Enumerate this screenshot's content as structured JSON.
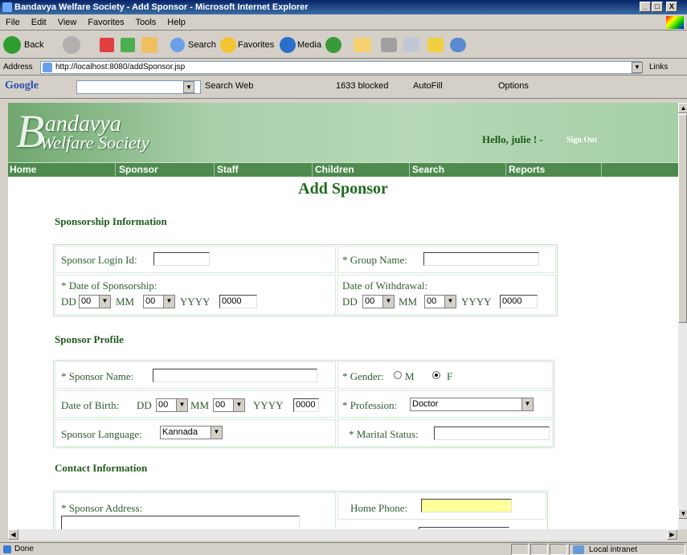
{
  "window": {
    "title": "Bandavya Welfare Society - Add Sponsor - Microsoft Internet Explorer",
    "controls": [
      "_",
      "□",
      "X"
    ]
  },
  "menu": [
    "File",
    "Edit",
    "View",
    "Favorites",
    "Tools",
    "Help"
  ],
  "toolbar": {
    "back": "Back",
    "search": "Search",
    "favorites": "Favorites",
    "media": "Media"
  },
  "address": {
    "label": "Address",
    "url": "http://localhost:8080/addSponsor.jsp",
    "links": "Links"
  },
  "googlebar": {
    "brand": "Google",
    "search_web": "Search Web",
    "blocked": "1633 blocked",
    "autofill": "AutoFill",
    "options": "Options"
  },
  "site": {
    "logo_big": "B",
    "logo_line1": "andavya",
    "logo_line2": "Welfare Society",
    "hello": "Hello,  julie ! -",
    "signout": "Sign Out"
  },
  "nav": [
    "Home",
    "Sponsor",
    "Staff",
    "Children",
    "Search",
    "Reports"
  ],
  "form": {
    "heading": "Add Sponsor",
    "sections": {
      "sponsorship": "Sponsorship Information",
      "profile": "Sponsor Profile",
      "contact": "Contact Information"
    },
    "login_id_label": "Sponsor Login Id:",
    "login_id_value": "",
    "group_name_label": "* Group Name:",
    "group_name_value": "",
    "dos_label": "* Date of Sponsorship:",
    "dow_label": "Date of Withdrawal:",
    "dd": "DD",
    "mm": "MM",
    "yyyy": "YYYY",
    "day_value": "00",
    "month_value": "00",
    "year_value": "0000",
    "name_label": "* Sponsor Name:",
    "name_value": "",
    "gender_label": "* Gender:",
    "gender_m": "M",
    "gender_f": "F",
    "gender_selected": "F",
    "dob_label": "Date of Birth:",
    "profession_label": "* Profession:",
    "profession_value": "Doctor",
    "language_label": "Sponsor Language:",
    "language_value": "Kannada",
    "marital_label": "* Marital Status:",
    "marital_value": "",
    "address_label": "* Sponsor Address:",
    "address_value": "",
    "home_phone_label": "Home Phone:",
    "home_phone_value": ""
  },
  "status": {
    "text": "Done",
    "zone": "Local intranet"
  },
  "colors": {
    "nav_bg": "#4e8a4e",
    "heading": "#1f6b1f",
    "highlight_input": "#ffff99"
  }
}
